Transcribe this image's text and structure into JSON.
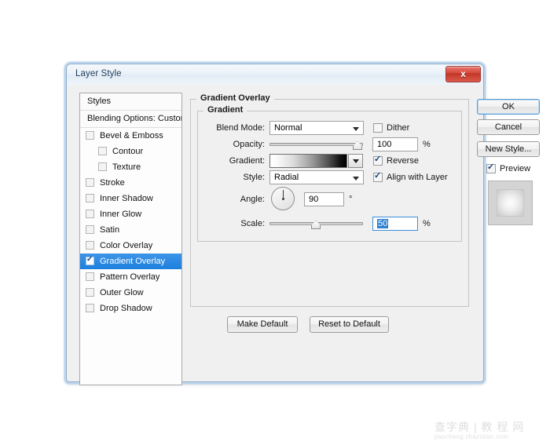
{
  "window": {
    "title": "Layer Style",
    "close_label": "x"
  },
  "styles_panel": {
    "header": "Styles",
    "blending_options": "Blending Options: Custom",
    "items": [
      {
        "label": "Bevel & Emboss",
        "checked": false,
        "indent": false,
        "selected": false
      },
      {
        "label": "Contour",
        "checked": false,
        "indent": true,
        "selected": false
      },
      {
        "label": "Texture",
        "checked": false,
        "indent": true,
        "selected": false
      },
      {
        "label": "Stroke",
        "checked": false,
        "indent": false,
        "selected": false
      },
      {
        "label": "Inner Shadow",
        "checked": false,
        "indent": false,
        "selected": false
      },
      {
        "label": "Inner Glow",
        "checked": false,
        "indent": false,
        "selected": false
      },
      {
        "label": "Satin",
        "checked": false,
        "indent": false,
        "selected": false
      },
      {
        "label": "Color Overlay",
        "checked": false,
        "indent": false,
        "selected": false
      },
      {
        "label": "Gradient Overlay",
        "checked": true,
        "indent": false,
        "selected": true
      },
      {
        "label": "Pattern Overlay",
        "checked": false,
        "indent": false,
        "selected": false
      },
      {
        "label": "Outer Glow",
        "checked": false,
        "indent": false,
        "selected": false
      },
      {
        "label": "Drop Shadow",
        "checked": false,
        "indent": false,
        "selected": false
      }
    ]
  },
  "main": {
    "section_title": "Gradient Overlay",
    "group_title": "Gradient",
    "blend_mode": {
      "label": "Blend Mode:",
      "value": "Normal"
    },
    "dither": {
      "label": "Dither",
      "checked": false
    },
    "opacity": {
      "label": "Opacity:",
      "value": "100",
      "unit": "%",
      "percent": 100
    },
    "gradient": {
      "label": "Gradient:",
      "from": "#ffffff",
      "to": "#000000"
    },
    "reverse": {
      "label": "Reverse",
      "checked": true
    },
    "style": {
      "label": "Style:",
      "value": "Radial"
    },
    "align_with_layer": {
      "label": "Align with Layer",
      "checked": true
    },
    "angle": {
      "label": "Angle:",
      "value": "90",
      "unit": "°",
      "degrees": 90
    },
    "scale": {
      "label": "Scale:",
      "value": "50",
      "unit": "%",
      "percent": 45
    },
    "make_default": "Make Default",
    "reset_to_default": "Reset to Default"
  },
  "actions": {
    "ok": "OK",
    "cancel": "Cancel",
    "new_style": "New Style...",
    "preview": {
      "label": "Preview",
      "checked": true
    }
  },
  "watermark": {
    "cn": "查字典 | 教 程 网",
    "url": "jiaocheng.chazidian.com"
  }
}
